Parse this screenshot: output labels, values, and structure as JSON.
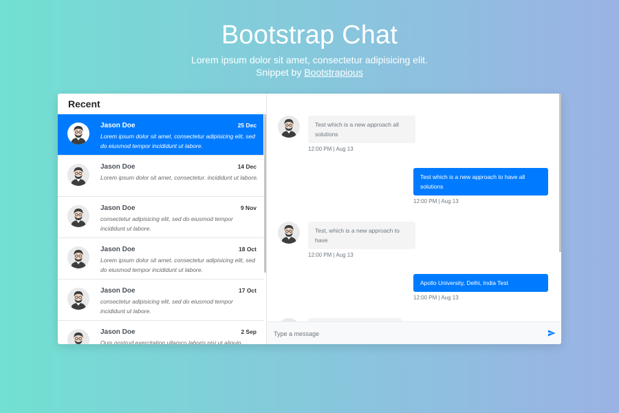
{
  "hero": {
    "title": "Bootstrap Chat",
    "subtitle": "Lorem ipsum dolor sit amet, consectetur adipisicing elit.",
    "snippet_prefix": "Snippet by ",
    "snippet_link": "Bootstrapious"
  },
  "recent": {
    "title": "Recent",
    "items": [
      {
        "name": "Jason Doe",
        "date": "25 Dec",
        "preview": "Lorem ipsum dolor sit amet, consectetur adipisicing elit, sed do eiusmod tempor incididunt ut labore.",
        "active": true
      },
      {
        "name": "Jason Doe",
        "date": "14 Dec",
        "preview": "Lorem ipsum dolor sit amet, consectetur. incididunt ut labore."
      },
      {
        "name": "Jason Doe",
        "date": "9 Nov",
        "preview": "consectetur adipisicing elit, sed do eiusmod tempor incididunt ut labore."
      },
      {
        "name": "Jason Doe",
        "date": "18 Oct",
        "preview": "Lorem ipsum dolor sit amet, consectetur adipisicing elit, sed do eiusmod tempor incididunt ut labore."
      },
      {
        "name": "Jason Doe",
        "date": "17 Oct",
        "preview": "consectetur adipisicing elit, sed do eiusmod tempor incididunt ut labore."
      },
      {
        "name": "Jason Doe",
        "date": "2 Sep",
        "preview": "Quis nostrud exercitation ullamco laboris nisi ut aliquip"
      }
    ]
  },
  "chat": {
    "messages": [
      {
        "direction": "in",
        "text": "Test which is a new approach all solutions",
        "time": "12:00 PM | Aug 13"
      },
      {
        "direction": "out",
        "text": "Test which is a new approach to have all solutions",
        "time": "12:00 PM | Aug 13"
      },
      {
        "direction": "in",
        "text": "Test, which is a new approach to have",
        "time": "12:00 PM | Aug 13"
      },
      {
        "direction": "out",
        "text": "Apollo University, Delhi, India Test",
        "time": "12:00 PM | Aug 13"
      }
    ],
    "input_placeholder": "Type a message"
  },
  "colors": {
    "accent": "#007bff"
  },
  "icons": {
    "avatar": "user-avatar-icon",
    "send": "send-icon"
  }
}
